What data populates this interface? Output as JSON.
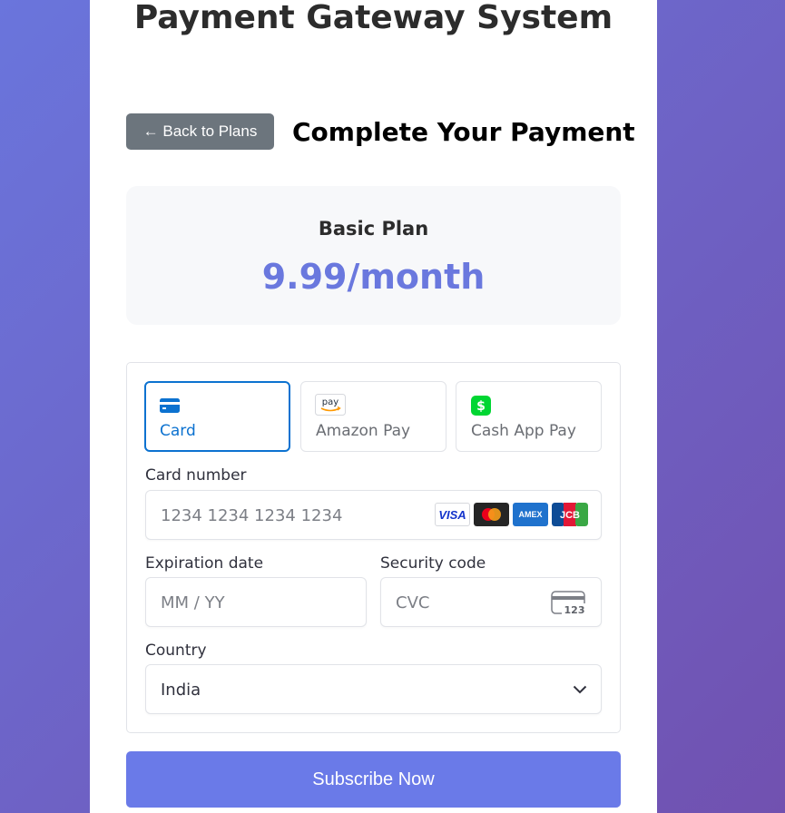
{
  "page": {
    "title": "Payment Gateway System"
  },
  "header": {
    "back_label": "← Back to Plans",
    "section_title": "Complete Your Payment"
  },
  "plan": {
    "name": "Basic Plan",
    "price": "9.99/month"
  },
  "payment_methods": [
    {
      "label": "Card",
      "icon": "card-icon",
      "selected": true
    },
    {
      "label": "Amazon Pay",
      "icon": "amazon-pay-icon",
      "selected": false
    },
    {
      "label": "Cash App Pay",
      "icon": "cash-app-icon",
      "selected": false
    }
  ],
  "icon_text": {
    "amazon": "pay",
    "cashapp": "$"
  },
  "card_number": {
    "label": "Card number",
    "placeholder": "1234 1234 1234 1234"
  },
  "card_brands": [
    "VISA",
    "Mastercard",
    "AMEX",
    "JCB"
  ],
  "expiry": {
    "label": "Expiration date",
    "placeholder": "MM / YY"
  },
  "cvc": {
    "label": "Security code",
    "placeholder": "CVC",
    "icon_text": "123"
  },
  "country": {
    "label": "Country",
    "value": "India"
  },
  "submit": {
    "label": "Subscribe Now"
  },
  "colors": {
    "accent": "#0c72d0",
    "price": "#6a78de",
    "button": "#6a7ae8",
    "back_button": "#6c757d"
  }
}
